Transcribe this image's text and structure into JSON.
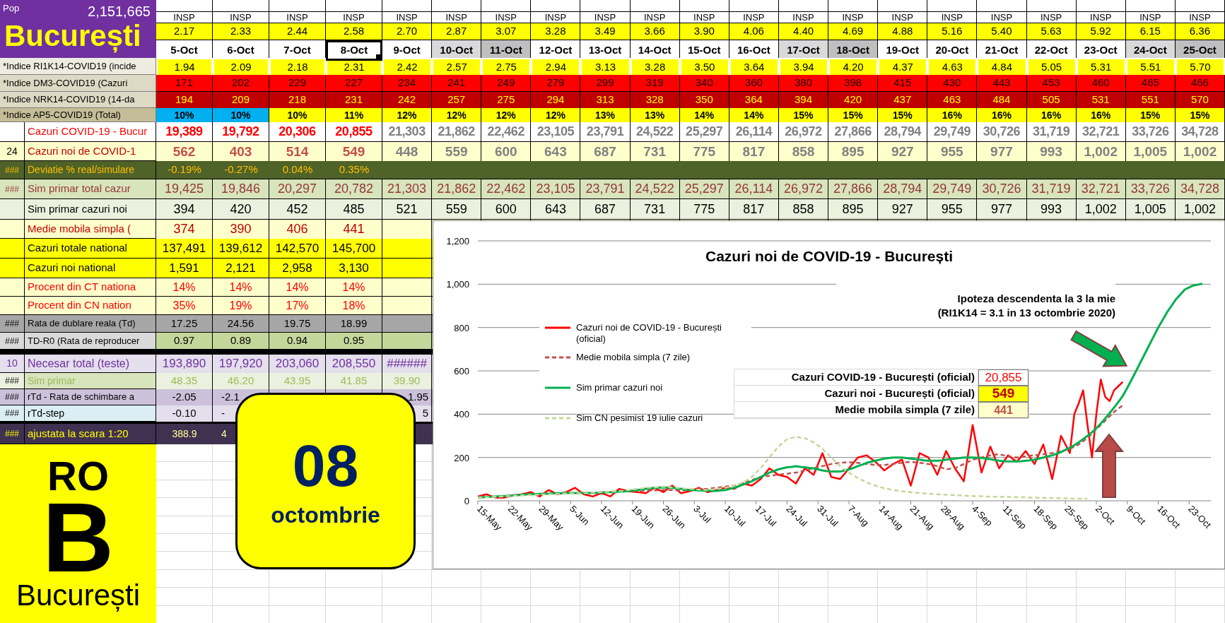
{
  "header": {
    "population_label": "Pop",
    "population": "2,151,665",
    "city": "București"
  },
  "sources": [
    "INSP",
    "INSP",
    "INSP",
    "INSP",
    "INSP",
    "INSP",
    "INSP",
    "INSP",
    "INSP",
    "INSP",
    "INSP",
    "INSP",
    "INSP",
    "INSP",
    "INSP",
    "INSP",
    "INSP",
    "INSP",
    "INSP",
    "INSP",
    "INSP"
  ],
  "forecast_values": [
    "2.17",
    "2.33",
    "2.44",
    "2.58",
    "2.70",
    "2.87",
    "3.07",
    "3.28",
    "3.49",
    "3.66",
    "3.90",
    "4.06",
    "4.40",
    "4.69",
    "4.88",
    "5.16",
    "5.40",
    "5.63",
    "5.92",
    "6.15",
    "6.36"
  ],
  "dates": [
    {
      "text": "5-Oct",
      "kind": "weekday",
      "selected": false
    },
    {
      "text": "6-Oct",
      "kind": "weekday",
      "selected": false
    },
    {
      "text": "7-Oct",
      "kind": "weekday",
      "selected": false
    },
    {
      "text": "8-Oct",
      "kind": "weekday",
      "selected": true
    },
    {
      "text": "9-Oct",
      "kind": "weekday",
      "selected": false
    },
    {
      "text": "10-Oct",
      "kind": "saturday",
      "selected": false
    },
    {
      "text": "11-Oct",
      "kind": "sunday",
      "selected": false
    },
    {
      "text": "12-Oct",
      "kind": "weekday",
      "selected": false
    },
    {
      "text": "13-Oct",
      "kind": "weekday",
      "selected": false
    },
    {
      "text": "14-Oct",
      "kind": "weekday",
      "selected": false
    },
    {
      "text": "15-Oct",
      "kind": "weekday",
      "selected": false
    },
    {
      "text": "16-Oct",
      "kind": "weekday",
      "selected": false
    },
    {
      "text": "17-Oct",
      "kind": "saturday",
      "selected": false
    },
    {
      "text": "18-Oct",
      "kind": "sunday",
      "selected": false
    },
    {
      "text": "19-Oct",
      "kind": "weekday",
      "selected": false
    },
    {
      "text": "20-Oct",
      "kind": "weekday",
      "selected": false
    },
    {
      "text": "21-Oct",
      "kind": "weekday",
      "selected": false
    },
    {
      "text": "22-Oct",
      "kind": "weekday",
      "selected": false
    },
    {
      "text": "23-Oct",
      "kind": "weekday",
      "selected": false
    },
    {
      "text": "24-Oct",
      "kind": "saturday",
      "selected": false
    },
    {
      "text": "25-Oct",
      "kind": "sunday",
      "selected": false
    }
  ],
  "rows": [
    {
      "kind": "ri1k14",
      "label": "*Indice RI1K14-COVID19 (incide",
      "cells": [
        "1.94",
        "2.09",
        "2.18",
        "2.31",
        "2.42",
        "2.57",
        "2.75",
        "2.94",
        "3.13",
        "3.28",
        "3.50",
        "3.64",
        "3.94",
        "4.20",
        "4.37",
        "4.63",
        "4.84",
        "5.05",
        "5.31",
        "5.51",
        "5.70"
      ]
    },
    {
      "kind": "dm3",
      "label": "*Indice DM3-COVID19 (Cazuri",
      "cells": [
        "171",
        "202",
        "229",
        "227",
        "234",
        "241",
        "249",
        "279",
        "299",
        "319",
        "340",
        "360",
        "380",
        "398",
        "415",
        "430",
        "443",
        "453",
        "460",
        "465",
        "466"
      ]
    },
    {
      "kind": "nrk14",
      "label": "*Indice NRK14-COVID19 (14-da",
      "cells": [
        "194",
        "209",
        "218",
        "231",
        "242",
        "257",
        "275",
        "294",
        "313",
        "328",
        "350",
        "364",
        "394",
        "420",
        "437",
        "463",
        "484",
        "505",
        "531",
        "551",
        "570"
      ]
    },
    {
      "kind": "ap5",
      "label": "*Indice AP5-COVID19 (Total)",
      "cells": [
        {
          "text": "10%",
          "color": "#00b0f0"
        },
        {
          "text": "10%",
          "color": "#00b0f0"
        },
        {
          "text": "10%",
          "color": "#ffff00"
        },
        {
          "text": "11%",
          "color": "#ffff00"
        },
        {
          "text": "12%",
          "color": "#ffff00"
        },
        {
          "text": "12%",
          "color": "#ffff00"
        },
        {
          "text": "12%",
          "color": "#ffff00"
        },
        {
          "text": "12%",
          "color": "#ffff00"
        },
        {
          "text": "13%",
          "color": "#ffff00"
        },
        {
          "text": "13%",
          "color": "#ffff00"
        },
        {
          "text": "14%",
          "color": "#ffff00"
        },
        {
          "text": "14%",
          "color": "#ffff00"
        },
        {
          "text": "15%",
          "color": "#ffff00"
        },
        {
          "text": "15%",
          "color": "#ffff00"
        },
        {
          "text": "15%",
          "color": "#ffff00"
        },
        {
          "text": "16%",
          "color": "#ffff00"
        },
        {
          "text": "16%",
          "color": "#ffff00"
        },
        {
          "text": "16%",
          "color": "#ffff00"
        },
        {
          "text": "16%",
          "color": "#ffff00"
        },
        {
          "text": "15%",
          "color": "#ffff00"
        },
        {
          "text": "15%",
          "color": "#ffff00"
        }
      ]
    },
    {
      "kind": "cases_total",
      "label": "Cazuri COVID-19 - Bucur",
      "cells": [
        {
          "text": "19,389",
          "kind": "reported"
        },
        {
          "text": "19,792",
          "kind": "reported"
        },
        {
          "text": "20,306",
          "kind": "reported"
        },
        {
          "text": "20,855",
          "kind": "reported"
        },
        {
          "text": "21,303",
          "kind": "projected"
        },
        {
          "text": "21,862",
          "kind": "projected"
        },
        {
          "text": "22,462",
          "kind": "projected"
        },
        {
          "text": "23,105",
          "kind": "projected"
        },
        {
          "text": "23,791",
          "kind": "projected"
        },
        {
          "text": "24,522",
          "kind": "projected"
        },
        {
          "text": "25,297",
          "kind": "projected"
        },
        {
          "text": "26,114",
          "kind": "projected"
        },
        {
          "text": "26,972",
          "kind": "projected"
        },
        {
          "text": "27,866",
          "kind": "projected"
        },
        {
          "text": "28,794",
          "kind": "projected"
        },
        {
          "text": "29,749",
          "kind": "projected"
        },
        {
          "text": "30,726",
          "kind": "projected"
        },
        {
          "text": "31,719",
          "kind": "projected"
        },
        {
          "text": "32,721",
          "kind": "projected"
        },
        {
          "text": "33,726",
          "kind": "projected"
        },
        {
          "text": "34,728",
          "kind": "projected"
        }
      ]
    },
    {
      "kind": "cases_new",
      "prefix": "24",
      "label": "Cazuri noi de COVID-1",
      "cells": [
        {
          "text": "562",
          "kind": "reported"
        },
        {
          "text": "403",
          "kind": "reported"
        },
        {
          "text": "514",
          "kind": "reported"
        },
        {
          "text": "549",
          "kind": "reported"
        },
        {
          "text": "448",
          "kind": "projected"
        },
        {
          "text": "559",
          "kind": "projected"
        },
        {
          "text": "600",
          "kind": "projected"
        },
        {
          "text": "643",
          "kind": "projected"
        },
        {
          "text": "687",
          "kind": "projected"
        },
        {
          "text": "731",
          "kind": "projected"
        },
        {
          "text": "775",
          "kind": "projected"
        },
        {
          "text": "817",
          "kind": "projected"
        },
        {
          "text": "858",
          "kind": "projected"
        },
        {
          "text": "895",
          "kind": "projected"
        },
        {
          "text": "927",
          "kind": "projected"
        },
        {
          "text": "955",
          "kind": "projected"
        },
        {
          "text": "977",
          "kind": "projected"
        },
        {
          "text": "993",
          "kind": "projected"
        },
        {
          "text": "1,002",
          "kind": "projected"
        },
        {
          "text": "1,005",
          "kind": "projected"
        },
        {
          "text": "1,002",
          "kind": "projected"
        }
      ]
    },
    {
      "kind": "deviation",
      "prefix": "###",
      "label": "Deviatie % real/simulare",
      "cells": [
        "-0.19%",
        "-0.27%",
        "0.04%",
        "0.35%"
      ]
    },
    {
      "kind": "sim_total",
      "prefix": "###",
      "label": "Sim primar total cazur",
      "cells": [
        "19,425",
        "19,846",
        "20,297",
        "20,782",
        "21,303",
        "21,862",
        "22,462",
        "23,105",
        "23,791",
        "24,522",
        "25,297",
        "26,114",
        "26,972",
        "27,866",
        "28,794",
        "29,749",
        "30,726",
        "31,719",
        "32,721",
        "33,726",
        "34,728"
      ]
    },
    {
      "kind": "sim_new",
      "label": "Sim primar cazuri noi",
      "cells": [
        "394",
        "420",
        "452",
        "485",
        "521",
        "559",
        "600",
        "643",
        "687",
        "731",
        "775",
        "817",
        "858",
        "895",
        "927",
        "955",
        "977",
        "993",
        "1,002",
        "1,005",
        "1,002"
      ]
    },
    {
      "kind": "moving_avg",
      "label": "Medie mobila simpla (",
      "cells": [
        "374",
        "390",
        "406",
        "441"
      ]
    },
    {
      "kind": "national",
      "label": "Cazuri totale national",
      "cells": [
        "137,491",
        "139,612",
        "142,570",
        "145,700"
      ]
    },
    {
      "kind": "national",
      "label": "Cazuri noi national",
      "cells": [
        "1,591",
        "2,121",
        "2,958",
        "3,130"
      ]
    },
    {
      "kind": "percent",
      "label": "Procent din CT nationa",
      "cells": [
        "14%",
        "14%",
        "14%",
        "14%"
      ]
    },
    {
      "kind": "percent",
      "label": "Procent din CN nation",
      "cells": [
        "35%",
        "19%",
        "17%",
        "18%"
      ]
    },
    {
      "kind": "doubling",
      "prefix": "###",
      "label": "Rata de dublare reala (Td)",
      "cells": [
        "17.25",
        "24.56",
        "19.75",
        "18.99"
      ]
    },
    {
      "kind": "r0",
      "prefix": "###",
      "label": "TD-R0 (Rata de reproducer",
      "cells": [
        "0.97",
        "0.89",
        "0.94",
        "0.95"
      ]
    },
    {
      "kind": "tests",
      "prefix": "10",
      "label": "Necesar total (teste)",
      "cells": [
        "193,890",
        "197,920",
        "203,060",
        "208,550",
        "######"
      ]
    },
    {
      "kind": "sim_primar",
      "prefix": "###",
      "label": "Sim primar",
      "cells": [
        "48.35",
        "46.20",
        "43.95",
        "41.85",
        "39.90"
      ]
    },
    {
      "kind": "rtd",
      "prefix": "###",
      "label": "rTd - Rata de schimbare a",
      "cells": [
        "-2.05",
        "-2.1",
        null,
        null,
        "1.95"
      ]
    },
    {
      "kind": "rtd_step",
      "prefix": "###",
      "label": "rTd-step",
      "cells": [
        "-0.10",
        "-",
        null,
        null,
        "5"
      ]
    },
    {
      "kind": "scaled",
      "prefix": "###",
      "label": "ajustata la scara 1:20",
      "cells": [
        "388.9",
        "4"
      ]
    }
  ],
  "sign": {
    "country": "RO",
    "letter": "B",
    "city": "București"
  },
  "date_badge": {
    "day": "08",
    "month": "octombrie"
  },
  "chart": {
    "chart_data": {
      "type": "line",
      "title": "Cazuri noi de COVID-19 - București",
      "categories": [
        "15-May",
        null,
        null,
        null,
        null,
        null,
        null,
        "22-May",
        null,
        null,
        null,
        null,
        null,
        null,
        "29-May",
        null,
        null,
        null,
        null,
        null,
        null,
        "5-Jun",
        null,
        null,
        null,
        null,
        null,
        null,
        "12-Jun",
        null,
        null,
        null,
        null,
        null,
        null,
        "19-Jun",
        null,
        null,
        null,
        null,
        null,
        null,
        "26-Jun",
        null,
        null,
        null,
        null,
        null,
        null,
        "3-Jul",
        null,
        null,
        null,
        null,
        null,
        null,
        "10-Jul",
        null,
        null,
        null,
        null,
        null,
        null,
        "17-Jul",
        null,
        null,
        null,
        null,
        null,
        null,
        "24-Jul",
        null,
        null,
        null,
        null,
        null,
        null,
        "31-Jul",
        null,
        null,
        null,
        null,
        null,
        null,
        "7-Aug",
        null,
        null,
        null,
        null,
        null,
        null,
        "14-Aug",
        null,
        null,
        null,
        null,
        null,
        null,
        "21-Aug",
        null,
        null,
        null,
        null,
        null,
        null,
        "28-Aug",
        null,
        null,
        null,
        null,
        null,
        null,
        "4-Sep",
        null,
        null,
        null,
        null,
        null,
        null,
        "11-Sep",
        null,
        null,
        null,
        null,
        null,
        null,
        "18-Sep",
        null,
        null,
        null,
        null,
        null,
        null,
        "25-Sep",
        null,
        null,
        null,
        null,
        null,
        null,
        "2-Oct",
        null,
        null,
        null,
        null,
        null,
        null,
        "9-Oct",
        null,
        null,
        null,
        null,
        null,
        null,
        "16-Oct",
        null,
        null,
        null,
        null,
        null,
        null,
        "23-Oct",
        null,
        null,
        null
      ],
      "grid": true,
      "legend": true,
      "ylim": [
        0,
        1200
      ],
      "yticks": [
        {
          "value": 0,
          "label": "0"
        },
        {
          "value": 200,
          "label": "200"
        },
        {
          "value": 400,
          "label": "400"
        },
        {
          "value": 600,
          "label": "600"
        },
        {
          "value": 800,
          "label": "800"
        },
        {
          "value": 1000,
          "label": "1,000"
        },
        {
          "value": 1200,
          "label": "1,200"
        }
      ],
      "series": [
        {
          "name": "Cazuri noi de COVID-19 - București (oficial)",
          "color": "#ff0000",
          "line_style": "solid",
          "values": [
            20,
            25,
            30,
            22,
            15,
            15,
            15,
            20,
            25,
            28,
            30,
            35,
            40,
            30,
            20,
            35,
            50,
            40,
            30,
            35,
            40,
            50,
            60,
            45,
            30,
            25,
            20,
            28,
            35,
            28,
            20,
            38,
            55,
            50,
            45,
            42,
            40,
            38,
            35,
            48,
            60,
            50,
            40,
            55,
            70,
            52,
            35,
            40,
            45,
            52,
            60,
            50,
            40,
            45,
            50,
            55,
            60,
            58,
            55,
            68,
            80,
            75,
            70,
            85,
            100,
            125,
            150,
            135,
            120,
            115,
            110,
            95,
            80,
            115,
            150,
            135,
            120,
            170,
            220,
            165,
            110,
            105,
            100,
            125,
            150,
            175,
            200,
            205,
            210,
            195,
            180,
            160,
            140,
            155,
            170,
            180,
            190,
            130,
            70,
            145,
            220,
            210,
            200,
            160,
            120,
            175,
            230,
            190,
            150,
            120,
            90,
            220,
            350,
            240,
            130,
            190,
            250,
            200,
            150,
            180,
            210,
            195,
            180,
            205,
            230,
            200,
            170,
            215,
            260,
            180,
            100,
            200,
            300,
            260,
            220,
            400,
            450,
            510,
            350,
            200,
            400,
            560,
            480,
            460,
            510,
            530,
            549,
            null,
            null,
            null,
            null,
            null,
            null,
            null,
            null,
            null,
            null,
            null,
            null,
            null,
            null,
            null,
            null,
            null,
            null
          ]
        },
        {
          "name": "Medie mobila simpla (7 zile)",
          "color": "#c0504d",
          "line_style": "dashed",
          "values": [
            18,
            18,
            18,
            19,
            20,
            21,
            22,
            24,
            25,
            27,
            28,
            29,
            30,
            31,
            32,
            33,
            33,
            34,
            34,
            35,
            35,
            36,
            36,
            36,
            36,
            37,
            38,
            39,
            40,
            41,
            42,
            43,
            44,
            45,
            45,
            46,
            46,
            47,
            48,
            48,
            48,
            49,
            50,
            50,
            50,
            49,
            48,
            49,
            50,
            51,
            52,
            54,
            55,
            58,
            60,
            63,
            65,
            68,
            70,
            75,
            80,
            88,
            95,
            103,
            110,
            113,
            115,
            118,
            120,
            123,
            125,
            128,
            130,
            135,
            140,
            145,
            150,
            155,
            160,
            165,
            170,
            173,
            175,
            177,
            178,
            177,
            175,
            173,
            170,
            168,
            165,
            165,
            165,
            168,
            170,
            173,
            175,
            178,
            180,
            178,
            175,
            173,
            170,
            165,
            160,
            153,
            145,
            148,
            150,
            160,
            170,
            180,
            190,
            195,
            200,
            205,
            210,
            213,
            215,
            210,
            205,
            203,
            200,
            203,
            205,
            208,
            210,
            213,
            215,
            218,
            220,
            225,
            230,
            235,
            240,
            250,
            260,
            275,
            290,
            310,
            330,
            350,
            370,
            390,
            410,
            426,
            441,
            null,
            null,
            null,
            null,
            null,
            null,
            null,
            null,
            null,
            null,
            null,
            null,
            null,
            null,
            null,
            null,
            null,
            null
          ]
        },
        {
          "name": "Sim primar cazuri noi",
          "color": "#00b050",
          "line_style": "solid",
          "values": [
            15,
            16,
            18,
            19,
            20,
            21,
            22,
            23,
            25,
            26,
            28,
            29,
            30,
            31,
            32,
            32,
            33,
            34,
            35,
            35,
            36,
            36,
            36,
            36,
            36,
            36,
            37,
            37,
            38,
            39,
            40,
            41,
            42,
            43,
            45,
            47,
            50,
            52,
            55,
            57,
            60,
            61,
            62,
            61,
            60,
            57,
            55,
            52,
            50,
            49,
            48,
            47,
            47,
            46,
            46,
            48,
            50,
            55,
            60,
            67,
            75,
            82,
            90,
            100,
            110,
            120,
            130,
            137,
            145,
            150,
            155,
            157,
            160,
            157,
            155,
            152,
            150,
            145,
            140,
            137,
            135,
            135,
            135,
            140,
            145,
            152,
            160,
            167,
            175,
            180,
            185,
            190,
            195,
            197,
            200,
            200,
            200,
            197,
            195,
            192,
            190,
            187,
            185,
            185,
            185,
            187,
            190,
            192,
            195,
            197,
            200,
            200,
            200,
            199,
            198,
            195,
            192,
            188,
            185,
            183,
            182,
            182,
            182,
            183,
            185,
            187,
            190,
            195,
            200,
            205,
            210,
            217,
            225,
            235,
            245,
            257,
            270,
            285,
            300,
            317,
            335,
            357,
            380,
            405,
            430,
            457,
            485,
            522,
            560,
            600,
            640,
            680,
            720,
            760,
            800,
            835,
            870,
            900,
            930,
            952,
            975,
            985,
            995,
            998,
            1002
          ]
        },
        {
          "name": "Sim CN pesimist 19 iulie cazuri",
          "color": "#c4d79b",
          "line_style": "dashed",
          "values": [
            15,
            16,
            17,
            18,
            19,
            20,
            21,
            22,
            23,
            24,
            25,
            26,
            27,
            28,
            29,
            29,
            30,
            31,
            32,
            33,
            34,
            34,
            35,
            35,
            36,
            37,
            38,
            39,
            40,
            41,
            42,
            43,
            45,
            47,
            50,
            52,
            55,
            57,
            60,
            61,
            62,
            63,
            65,
            63,
            62,
            60,
            58,
            56,
            55,
            53,
            52,
            51,
            50,
            52,
            55,
            57,
            60,
            65,
            70,
            77,
            85,
            97,
            110,
            130,
            150,
            175,
            200,
            225,
            250,
            267,
            285,
            290,
            295,
            292,
            290,
            280,
            270,
            255,
            240,
            220,
            200,
            180,
            160,
            145,
            130,
            117,
            105,
            95,
            85,
            77,
            70,
            64,
            58,
            54,
            50,
            47,
            44,
            42,
            40,
            38,
            36,
            34,
            33,
            31,
            30,
            29,
            28,
            27,
            26,
            25,
            24,
            23,
            22,
            21,
            21,
            20,
            20,
            19,
            19,
            18,
            18,
            17,
            17,
            16,
            16,
            15,
            15,
            14,
            14,
            13,
            13,
            12,
            12,
            11,
            11,
            10,
            10,
            10,
            10,
            null,
            null,
            null,
            null,
            null,
            null,
            null,
            null,
            null,
            null,
            null,
            null,
            null,
            null,
            null,
            null,
            null,
            null,
            null,
            null,
            null,
            null,
            null,
            null,
            null,
            null
          ]
        }
      ],
      "annotations": [
        "Ipoteza descendenta la 3 la mie",
        "(RI1K14 = 3.1 in 13 octombrie 2020)"
      ]
    }
  },
  "chart_inset": [
    {
      "label": "Cazuri COVID-19 - București (oficial)",
      "value": "20,855",
      "kind": "total"
    },
    {
      "label": "Cazuri noi - București (oficial)",
      "value": "549",
      "kind": "new"
    },
    {
      "label": "Medie mobila simpla (7 zile)",
      "value": "441",
      "kind": "average"
    }
  ]
}
